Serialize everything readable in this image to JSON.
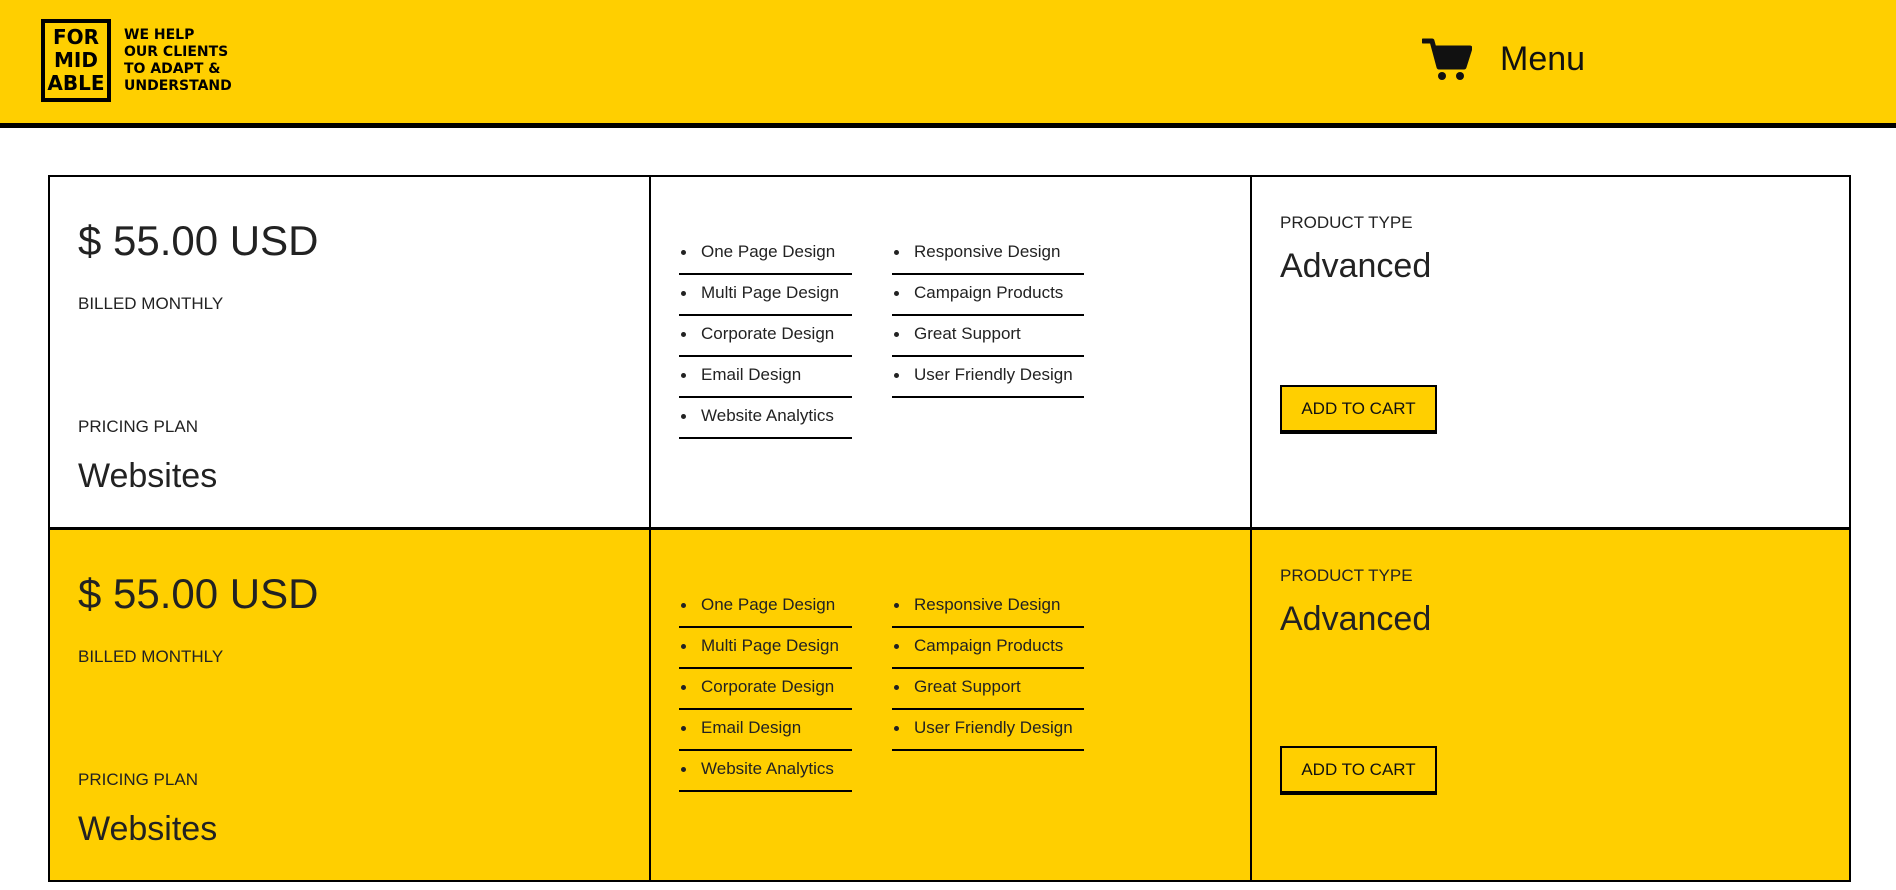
{
  "header": {
    "logo_text": [
      "FOR",
      "MID",
      "ABLE"
    ],
    "tagline": [
      "WE HELP",
      "OUR CLIENTS",
      "TO ADAPT &",
      "UNDERSTAND"
    ],
    "cart_icon": "shopping-cart-icon",
    "menu_label": "Menu"
  },
  "plans": [
    {
      "price": "$ 55.00 USD",
      "billing": "BILLED MONTHLY",
      "plan_label": "PRICING PLAN",
      "plan_name": "Websites",
      "features_left": [
        "One Page Design",
        "Multi Page Design",
        "Corporate Design",
        "Email Design",
        "Website Analytics"
      ],
      "features_right": [
        "Responsive Design",
        "Campaign Products",
        "Great Support",
        "User Friendly Design"
      ],
      "type_label": "PRODUCT TYPE",
      "type_name": "Advanced",
      "button_label": "ADD TO CART"
    },
    {
      "price": "$ 55.00 USD",
      "billing": "BILLED MONTHLY",
      "plan_label": "PRICING PLAN",
      "plan_name": "Websites",
      "features_left": [
        "One Page Design",
        "Multi Page Design",
        "Corporate Design",
        "Email Design",
        "Website Analytics"
      ],
      "features_right": [
        "Responsive Design",
        "Campaign Products",
        "Great Support",
        "User Friendly Design"
      ],
      "type_label": "PRODUCT TYPE",
      "type_name": "Advanced",
      "button_label": "ADD TO CART"
    }
  ],
  "colors": {
    "brand_yellow": "#ffcf00",
    "border": "#000000",
    "text": "#222222"
  }
}
